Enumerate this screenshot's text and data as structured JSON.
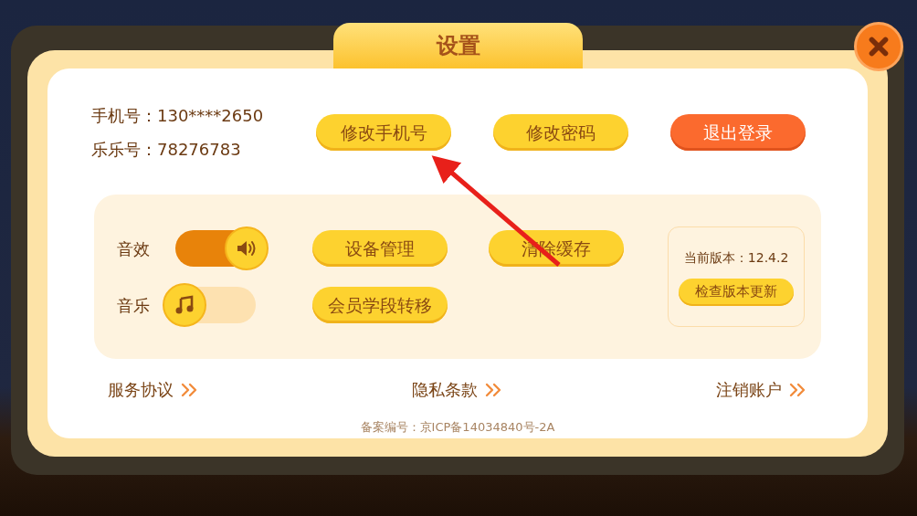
{
  "dialog": {
    "title": "设置"
  },
  "account": [
    {
      "label": "手机号：",
      "value": "130****2650"
    },
    {
      "label": "乐乐号：",
      "value": "78276783"
    }
  ],
  "account_buttons": [
    {
      "label": "修改手机号",
      "kind": "primary"
    },
    {
      "label": "修改密码",
      "kind": "primary"
    },
    {
      "label": "退出登录",
      "kind": "danger"
    }
  ],
  "toggles": [
    {
      "label": "音效",
      "on": true,
      "kind": "sound"
    },
    {
      "label": "音乐",
      "on": false,
      "kind": "music"
    }
  ],
  "actions": [
    "设备管理",
    "清除缓存",
    "会员学段转移"
  ],
  "version": {
    "text": "当前版本：12.4.2",
    "button": "检查版本更新"
  },
  "links": [
    "服务协议",
    "隐私条款",
    "注销账户"
  ],
  "footer": "备案编号：京ICP备14034840号-2A"
}
